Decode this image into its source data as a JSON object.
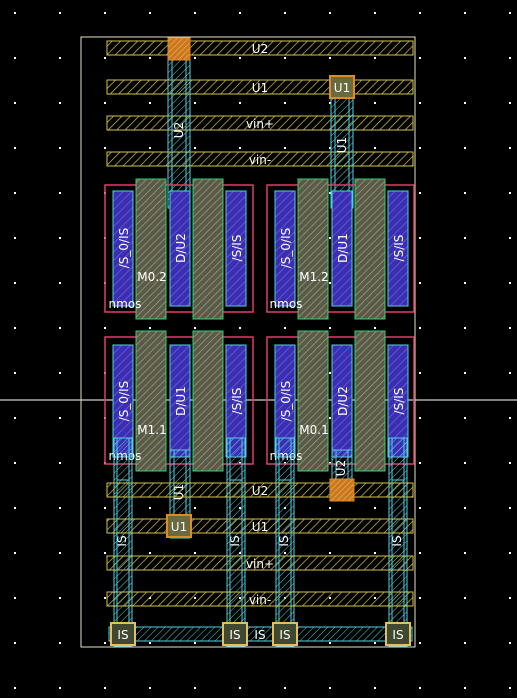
{
  "colors": {
    "background": "#000000",
    "boundary": "#e8e0c8",
    "poly": "#d4c24a",
    "metal1": "#4fd0e0",
    "device_outline": "#e03c6a",
    "diffusion_fill": "#3a2fb0",
    "gate": "#33d070",
    "gate_fill": "#8a8a70",
    "contact": "#e08a20",
    "text": "#ffffff",
    "grid_dot": "#ffffff"
  },
  "rails": {
    "top": [
      "U2",
      "U1",
      "vin+",
      "vin-"
    ],
    "bottom": [
      "U2",
      "U1",
      "vin+",
      "vin-"
    ],
    "source_bus": "IS"
  },
  "devices": {
    "m02": {
      "name": "M0.2",
      "type": "nmos",
      "left_term": "/S_0/IS",
      "mid_term": "D/U2",
      "right_term": "/S/IS"
    },
    "m12": {
      "name": "M1.2",
      "type": "nmos",
      "left_term": "/S_0/IS",
      "mid_term": "D/U1",
      "right_term": "/S/IS"
    },
    "m11": {
      "name": "M1.1",
      "type": "nmos",
      "left_term": "/S_0/IS",
      "mid_term": "D/U1",
      "right_term": "/S/IS"
    },
    "m01": {
      "name": "M0.1",
      "type": "nmos",
      "left_term": "/S_0/IS",
      "mid_term": "D/U2",
      "right_term": "/S/IS"
    }
  },
  "pins": {
    "u1_top": "U1",
    "u1_bottom": "U1",
    "is_pins": [
      "IS",
      "IS",
      "IS",
      "IS"
    ]
  },
  "wires": {
    "top_left_vertical": "U2",
    "top_right_vertical": "U1",
    "bottom_left_vertical": "U1",
    "bottom_right_vertical": "U2",
    "source_verticals": [
      "IS",
      "IS",
      "IS",
      "IS"
    ]
  }
}
